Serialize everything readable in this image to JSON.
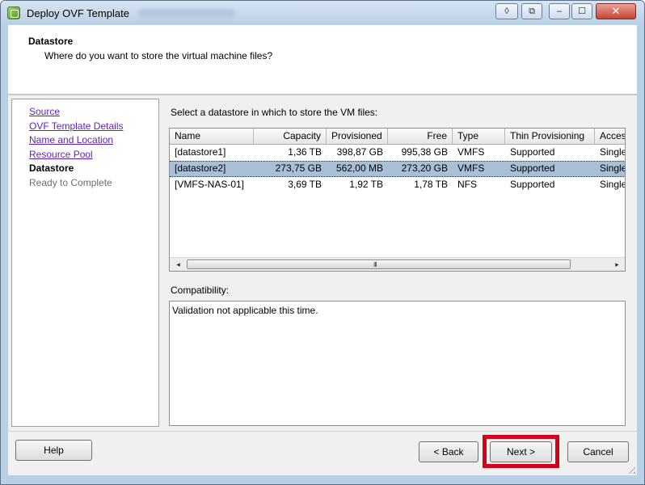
{
  "window": {
    "title": "Deploy OVF Template",
    "controls": {
      "restore": "◊",
      "copy": "⧉",
      "minimize": "‒",
      "maximize": "☐",
      "close": "✕"
    }
  },
  "header": {
    "title": "Datastore",
    "subtitle": "Where do you want to store the virtual machine files?"
  },
  "nav": {
    "items": [
      {
        "label": "Source"
      },
      {
        "label": "OVF Template Details"
      },
      {
        "label": "Name and Location"
      },
      {
        "label": "Resource Pool"
      },
      {
        "label": "Datastore"
      },
      {
        "label": "Ready to Complete"
      }
    ]
  },
  "main": {
    "prompt": "Select a datastore in which to store the VM files:",
    "table": {
      "columns": [
        "Name",
        "Capacity",
        "Provisioned",
        "Free",
        "Type",
        "Thin Provisioning",
        "Access"
      ],
      "rows": [
        [
          "[datastore1]",
          "1,36 TB",
          "398,87 GB",
          "995,38 GB",
          "VMFS",
          "Supported",
          "Single"
        ],
        [
          "[datastore2]",
          "273,75 GB",
          "562,00 MB",
          "273,20 GB",
          "VMFS",
          "Supported",
          "Single"
        ],
        [
          "[VMFS-NAS-01]",
          "3,69 TB",
          "1,92 TB",
          "1,78 TB",
          "NFS",
          "Supported",
          "Single"
        ]
      ],
      "selected_row": 1,
      "scroll": {
        "left_arrow": "◂",
        "right_arrow": "▸",
        "grip": "III"
      }
    },
    "compatibility_label": "Compatibility:",
    "compatibility_text": "Validation not applicable this time."
  },
  "footer": {
    "help": "Help",
    "back": "< Back",
    "next": "Next >",
    "cancel": "Cancel"
  },
  "colors": {
    "highlight_border": "#d0021b",
    "selected_row": "#a9bfd6",
    "link": "#5c1fc7"
  }
}
